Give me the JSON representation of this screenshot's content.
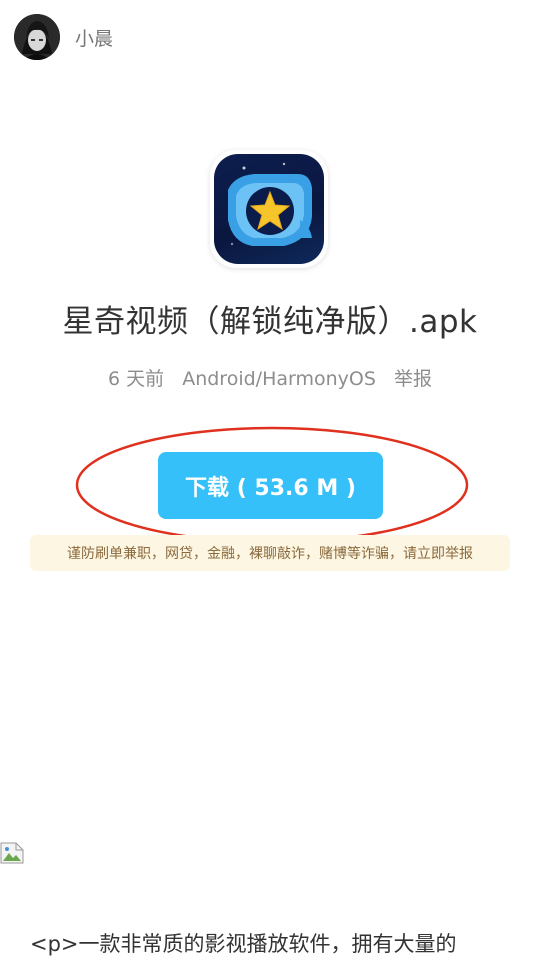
{
  "author": {
    "name": "小晨",
    "avatar_icon": "anime-avatar"
  },
  "app": {
    "icon": "star-video-app-icon",
    "title": "星奇视频（解锁纯净版）.apk",
    "time": "6 天前",
    "platform": "Android/HarmonyOS",
    "report_label": "举报"
  },
  "download": {
    "label": "下载 ( 53.6 M )",
    "highlight_color": "#e0301e",
    "button_color": "#35c0fa"
  },
  "warning": {
    "text": "谨防刷单兼职，网贷，金融，裸聊敲诈，赌博等诈骗，请立即举报"
  },
  "content": {
    "image_icon": "broken-image-icon",
    "description": "<p>一款非常质的影视播放软件，拥有大量的"
  }
}
